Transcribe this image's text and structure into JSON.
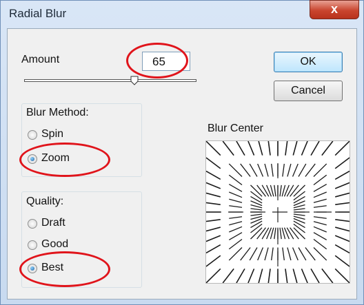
{
  "window": {
    "title": "Radial Blur",
    "close_glyph": "x"
  },
  "amount": {
    "label": "Amount",
    "value": "65",
    "slider_fraction": 0.65
  },
  "buttons": {
    "ok": "OK",
    "cancel": "Cancel"
  },
  "blur_method": {
    "label": "Blur Method:",
    "options": [
      {
        "label": "Spin",
        "checked": false
      },
      {
        "label": "Zoom",
        "checked": true
      }
    ]
  },
  "quality": {
    "label": "Quality:",
    "options": [
      {
        "label": "Draft",
        "checked": false
      },
      {
        "label": "Good",
        "checked": false
      },
      {
        "label": "Best",
        "checked": true
      }
    ]
  },
  "blur_center": {
    "label": "Blur Center"
  },
  "colors": {
    "highlight_ellipse": "#e0141b",
    "default_button": "#3c7fb1"
  }
}
